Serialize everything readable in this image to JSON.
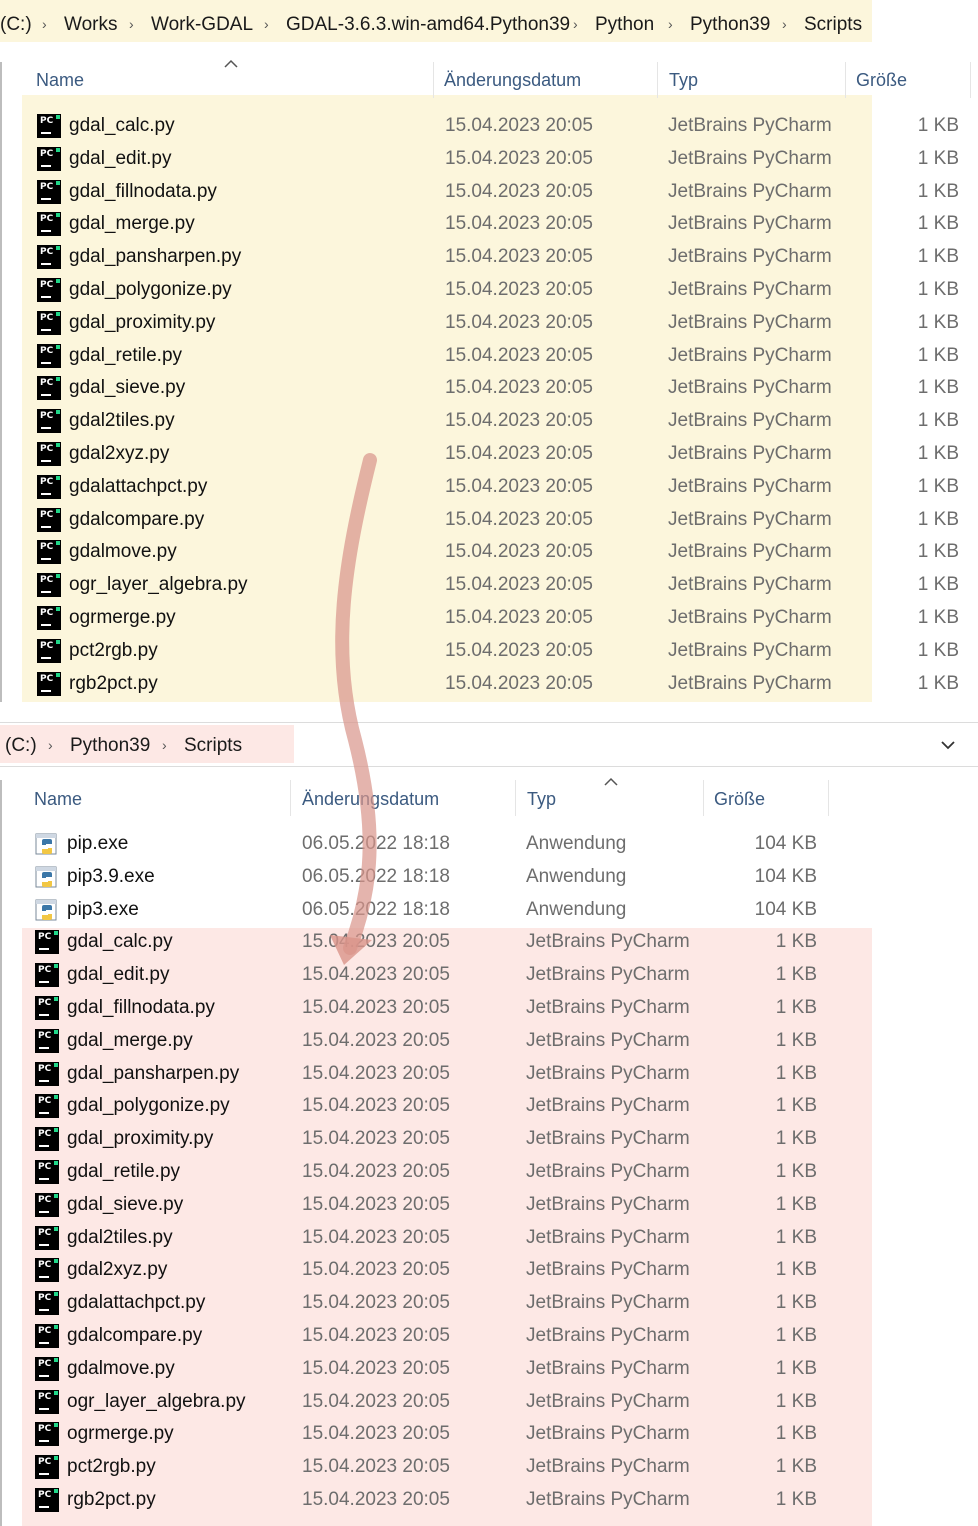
{
  "top_window": {
    "breadcrumb": [
      "(C:)",
      "Works",
      "Work-GDAL",
      "GDAL-3.6.3.win-amd64.Python39",
      "Python",
      "Python39",
      "Scripts"
    ],
    "columns": {
      "name": "Name",
      "date": "Änderungsdatum",
      "type": "Typ",
      "size": "Größe"
    },
    "files": [
      {
        "name": "gdal_calc.py",
        "date": "15.04.2023 20:05",
        "type": "JetBrains PyCharm",
        "size": "1 KB"
      },
      {
        "name": "gdal_edit.py",
        "date": "15.04.2023 20:05",
        "type": "JetBrains PyCharm",
        "size": "1 KB"
      },
      {
        "name": "gdal_fillnodata.py",
        "date": "15.04.2023 20:05",
        "type": "JetBrains PyCharm",
        "size": "1 KB"
      },
      {
        "name": "gdal_merge.py",
        "date": "15.04.2023 20:05",
        "type": "JetBrains PyCharm",
        "size": "1 KB"
      },
      {
        "name": "gdal_pansharpen.py",
        "date": "15.04.2023 20:05",
        "type": "JetBrains PyCharm",
        "size": "1 KB"
      },
      {
        "name": "gdal_polygonize.py",
        "date": "15.04.2023 20:05",
        "type": "JetBrains PyCharm",
        "size": "1 KB"
      },
      {
        "name": "gdal_proximity.py",
        "date": "15.04.2023 20:05",
        "type": "JetBrains PyCharm",
        "size": "1 KB"
      },
      {
        "name": "gdal_retile.py",
        "date": "15.04.2023 20:05",
        "type": "JetBrains PyCharm",
        "size": "1 KB"
      },
      {
        "name": "gdal_sieve.py",
        "date": "15.04.2023 20:05",
        "type": "JetBrains PyCharm",
        "size": "1 KB"
      },
      {
        "name": "gdal2tiles.py",
        "date": "15.04.2023 20:05",
        "type": "JetBrains PyCharm",
        "size": "1 KB"
      },
      {
        "name": "gdal2xyz.py",
        "date": "15.04.2023 20:05",
        "type": "JetBrains PyCharm",
        "size": "1 KB"
      },
      {
        "name": "gdalattachpct.py",
        "date": "15.04.2023 20:05",
        "type": "JetBrains PyCharm",
        "size": "1 KB"
      },
      {
        "name": "gdalcompare.py",
        "date": "15.04.2023 20:05",
        "type": "JetBrains PyCharm",
        "size": "1 KB"
      },
      {
        "name": "gdalmove.py",
        "date": "15.04.2023 20:05",
        "type": "JetBrains PyCharm",
        "size": "1 KB"
      },
      {
        "name": "ogr_layer_algebra.py",
        "date": "15.04.2023 20:05",
        "type": "JetBrains PyCharm",
        "size": "1 KB"
      },
      {
        "name": "ogrmerge.py",
        "date": "15.04.2023 20:05",
        "type": "JetBrains PyCharm",
        "size": "1 KB"
      },
      {
        "name": "pct2rgb.py",
        "date": "15.04.2023 20:05",
        "type": "JetBrains PyCharm",
        "size": "1 KB"
      },
      {
        "name": "rgb2pct.py",
        "date": "15.04.2023 20:05",
        "type": "JetBrains PyCharm",
        "size": "1 KB"
      }
    ]
  },
  "bottom_window": {
    "breadcrumb": [
      "(C:)",
      "Python39",
      "Scripts"
    ],
    "columns": {
      "name": "Name",
      "date": "Änderungsdatum",
      "type": "Typ",
      "size": "Größe"
    },
    "files": [
      {
        "name": "pip.exe",
        "date": "06.05.2022 18:18",
        "type": "Anwendung",
        "size": "104 KB",
        "icon": "python-exe-icon"
      },
      {
        "name": "pip3.9.exe",
        "date": "06.05.2022 18:18",
        "type": "Anwendung",
        "size": "104 KB",
        "icon": "python-exe-icon"
      },
      {
        "name": "pip3.exe",
        "date": "06.05.2022 18:18",
        "type": "Anwendung",
        "size": "104 KB",
        "icon": "python-exe-icon"
      },
      {
        "name": "gdal_calc.py",
        "date": "15.04.2023 20:05",
        "type": "JetBrains PyCharm",
        "size": "1 KB",
        "icon": "pycharm-file-icon"
      },
      {
        "name": "gdal_edit.py",
        "date": "15.04.2023 20:05",
        "type": "JetBrains PyCharm",
        "size": "1 KB",
        "icon": "pycharm-file-icon"
      },
      {
        "name": "gdal_fillnodata.py",
        "date": "15.04.2023 20:05",
        "type": "JetBrains PyCharm",
        "size": "1 KB",
        "icon": "pycharm-file-icon"
      },
      {
        "name": "gdal_merge.py",
        "date": "15.04.2023 20:05",
        "type": "JetBrains PyCharm",
        "size": "1 KB",
        "icon": "pycharm-file-icon"
      },
      {
        "name": "gdal_pansharpen.py",
        "date": "15.04.2023 20:05",
        "type": "JetBrains PyCharm",
        "size": "1 KB",
        "icon": "pycharm-file-icon"
      },
      {
        "name": "gdal_polygonize.py",
        "date": "15.04.2023 20:05",
        "type": "JetBrains PyCharm",
        "size": "1 KB",
        "icon": "pycharm-file-icon"
      },
      {
        "name": "gdal_proximity.py",
        "date": "15.04.2023 20:05",
        "type": "JetBrains PyCharm",
        "size": "1 KB",
        "icon": "pycharm-file-icon"
      },
      {
        "name": "gdal_retile.py",
        "date": "15.04.2023 20:05",
        "type": "JetBrains PyCharm",
        "size": "1 KB",
        "icon": "pycharm-file-icon"
      },
      {
        "name": "gdal_sieve.py",
        "date": "15.04.2023 20:05",
        "type": "JetBrains PyCharm",
        "size": "1 KB",
        "icon": "pycharm-file-icon"
      },
      {
        "name": "gdal2tiles.py",
        "date": "15.04.2023 20:05",
        "type": "JetBrains PyCharm",
        "size": "1 KB",
        "icon": "pycharm-file-icon"
      },
      {
        "name": "gdal2xyz.py",
        "date": "15.04.2023 20:05",
        "type": "JetBrains PyCharm",
        "size": "1 KB",
        "icon": "pycharm-file-icon"
      },
      {
        "name": "gdalattachpct.py",
        "date": "15.04.2023 20:05",
        "type": "JetBrains PyCharm",
        "size": "1 KB",
        "icon": "pycharm-file-icon"
      },
      {
        "name": "gdalcompare.py",
        "date": "15.04.2023 20:05",
        "type": "JetBrains PyCharm",
        "size": "1 KB",
        "icon": "pycharm-file-icon"
      },
      {
        "name": "gdalmove.py",
        "date": "15.04.2023 20:05",
        "type": "JetBrains PyCharm",
        "size": "1 KB",
        "icon": "pycharm-file-icon"
      },
      {
        "name": "ogr_layer_algebra.py",
        "date": "15.04.2023 20:05",
        "type": "JetBrains PyCharm",
        "size": "1 KB",
        "icon": "pycharm-file-icon"
      },
      {
        "name": "ogrmerge.py",
        "date": "15.04.2023 20:05",
        "type": "JetBrains PyCharm",
        "size": "1 KB",
        "icon": "pycharm-file-icon"
      },
      {
        "name": "pct2rgb.py",
        "date": "15.04.2023 20:05",
        "type": "JetBrains PyCharm",
        "size": "1 KB",
        "icon": "pycharm-file-icon"
      },
      {
        "name": "rgb2pct.py",
        "date": "15.04.2023 20:05",
        "type": "JetBrains PyCharm",
        "size": "1 KB",
        "icon": "pycharm-file-icon"
      }
    ]
  },
  "colors": {
    "highlight_yellow": "#fcf6dc",
    "highlight_pink": "#fde8e5",
    "arrow": "#d9948a",
    "header_text": "#3b5a80"
  }
}
